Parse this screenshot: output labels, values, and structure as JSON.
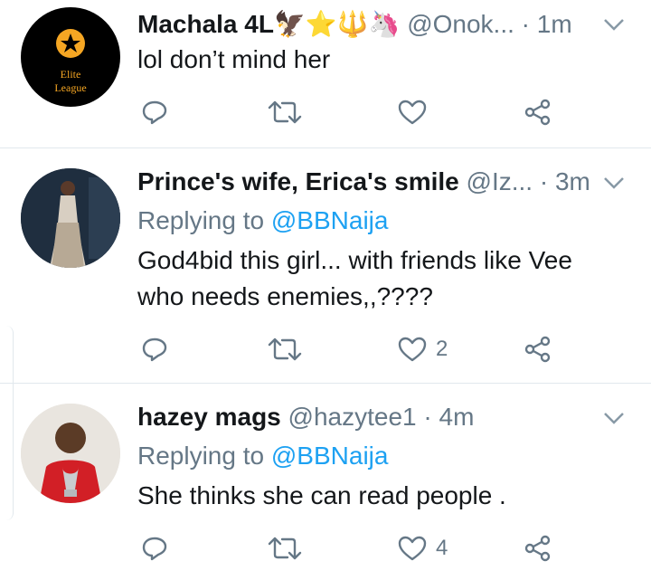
{
  "tweets": [
    {
      "name": "Machala 4L",
      "emoji": "🦅⭐🔱🦄",
      "handle": "@Onok...",
      "dot": "·",
      "time": "1m",
      "avatar_text": [
        "Elite",
        "League"
      ],
      "text_lines": [
        "lol don’t mind her"
      ],
      "like_count": ""
    },
    {
      "name": "Prince's wife, Erica's smile",
      "handle": "@Iz...",
      "dot": "·",
      "time": "3m",
      "replying_prefix": "Replying to ",
      "replying_to": "@BBNaija",
      "text_lines": [
        "God4bid this girl... with friends like Vee",
        "who needs enemies,,????"
      ],
      "like_count": "2"
    },
    {
      "name": "hazey mags",
      "handle": "@hazytee1",
      "dot": "·",
      "time": "4m",
      "replying_prefix": "Replying to ",
      "replying_to": "@BBNaija",
      "text_lines": [
        "She thinks she can read people ."
      ],
      "like_count": "4"
    }
  ],
  "colors": {
    "link": "#1da1f2",
    "muted": "#657786",
    "divider": "#e1e8ed"
  }
}
